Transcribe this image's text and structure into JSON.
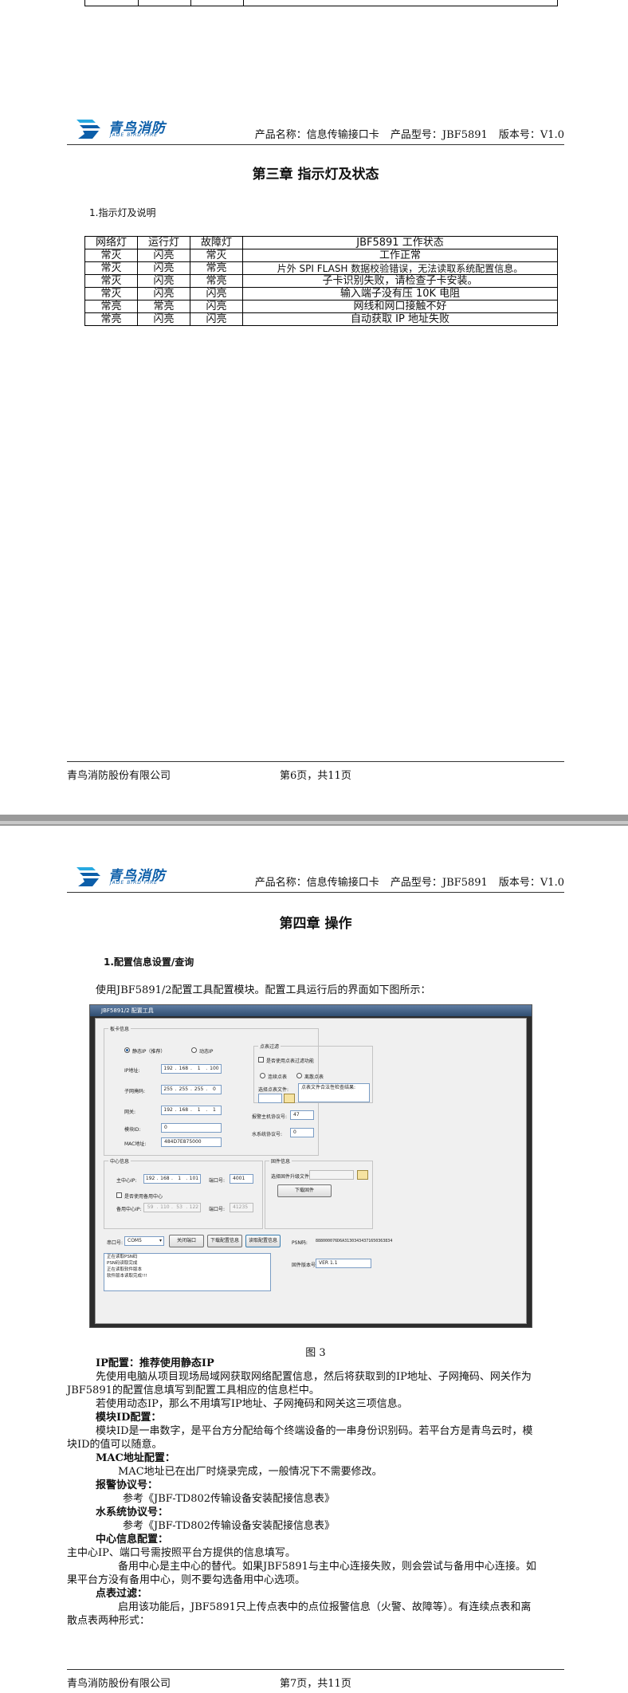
{
  "header": {
    "logo_cn": "青鸟消防",
    "logo_en": "JADE BIRD FIRE",
    "product_name": "产品名称：信息传输接口卡",
    "product_model": "产品型号：JBF5891",
    "version": "版本号：V1.0"
  },
  "page6": {
    "chapter_title": "第三章  指示灯及状态",
    "section_title": "1.指示灯及说明",
    "table": {
      "headers": [
        "网络灯",
        "运行灯",
        "故障灯",
        "JBF5891 工作状态"
      ],
      "rows": [
        [
          "常灭",
          "闪亮",
          "常灭",
          "工作正常"
        ],
        [
          "常灭",
          "闪亮",
          "常亮",
          "片外 SPI FLASH 数据校验错误，无法读取系统配置信息。"
        ],
        [
          "常灭",
          "闪亮",
          "常亮",
          "子卡识别失败，请检查子卡安装。"
        ],
        [
          "常灭",
          "闪亮",
          "闪亮",
          "输入端子没有压 10K 电阻"
        ],
        [
          "常亮",
          "常亮",
          "闪亮",
          "网线和网口接触不好"
        ],
        [
          "常亮",
          "闪亮",
          "闪亮",
          "自动获取 IP 地址失败"
        ]
      ]
    },
    "footer_company": "青鸟消防股份有限公司",
    "footer_page": "第6页，共11页"
  },
  "page7": {
    "chapter_title": "第四章  操作",
    "section_title": "1.配置信息设置/查询",
    "intro": "使用JBF5891/2配置工具配置模块。配置工具运行后的界面如下图所示：",
    "figure_caption": "图 3",
    "tool": {
      "window_title": "JBF5891/2 配置工具",
      "board_group": "板卡信息",
      "static_ip": "静态IP（推荐）",
      "dynamic_ip": "动态IP",
      "ip_label": "IP地址:",
      "ip_value": [
        "192",
        "168",
        "1",
        "100"
      ],
      "mask_label": "子网掩码:",
      "mask_value": [
        "255",
        "255",
        "255",
        "0"
      ],
      "gateway_label": "网关:",
      "gateway_value": [
        "192",
        "168",
        "1",
        "1"
      ],
      "module_id_label": "模块ID:",
      "module_id_value": "0",
      "mac_label": "MAC地址:",
      "mac_value": "484D7E875000",
      "filter_group": "点表过滤",
      "enable_filter": "是否使用点表过滤功能",
      "continuous_table": "连续点表",
      "discrete_table": "离散点表",
      "select_table_file": "选择点表文件:",
      "table_hint": "点表文件合法性检查结果:",
      "alarm_protocol_label": "报警主机协议号:",
      "alarm_protocol_value": "47",
      "water_protocol_label": "水系统协议号:",
      "water_protocol_value": "0",
      "center_group": "中心信息",
      "main_center_ip_label": "主中心IP:",
      "main_center_ip_value": [
        "192",
        "168",
        "1",
        "101"
      ],
      "main_port_label": "端口号:",
      "main_port_value": "4001",
      "use_backup": "是否使用备用中心",
      "backup_ip_label": "备用中心IP:",
      "backup_ip_value": [
        "59",
        "110",
        "53",
        "122"
      ],
      "backup_port_label": "端口号:",
      "backup_port_value": "41235",
      "firmware_group": "固件信息",
      "select_firmware": "选择固件升级文件:",
      "download_firmware": "下载固件",
      "serial_label": "串口号:",
      "serial_value": "COM5",
      "close_port": "关闭端口",
      "download_config": "下载配置信息",
      "read_config": "读取配置信息",
      "log_lines": [
        "正在读取PSN码",
        "PSN码读取完成",
        "正在读取软件版本",
        "软件版本读取完成!!!"
      ],
      "psn_label": "PSN码:",
      "psn_value": "888000076D6A31303434371650363834",
      "firmware_version_label": "固件版本号:",
      "firmware_version_value": "VER 1.1"
    },
    "items": [
      {
        "title": "IP配置：推荐使用静态IP",
        "lines": [
          "先使用电脑从项目现场局域网获取网络配置信息，然后将获取到的IP地址、子网掩码、网关作为",
          "JBF5891的配置信息填写到配置工具相应的信息栏中。",
          "若使用动态IP，那么不用填写IP地址、子网掩码和网关这三项信息。"
        ]
      },
      {
        "title": "模块ID配置：",
        "lines": [
          "模块ID是一串数字，是平台方分配给每个终端设备的一串身份识别码。若平台方是青鸟云时，模",
          "块ID的值可以随意。"
        ]
      },
      {
        "title": "MAC地址配置：",
        "lines": [
          "MAC地址已在出厂时烧录完成，一般情况下不需要修改。"
        ]
      },
      {
        "title": "报警协议号：",
        "lines": [
          "参考《JBF-TD802传输设备安装配接信息表》"
        ]
      },
      {
        "title": "水系统协议号：",
        "lines": [
          "参考《JBF-TD802传输设备安装配接信息表》"
        ]
      },
      {
        "title": "中心信息配置：",
        "lines": [
          "主中心IP、端口号需按照平台方提供的信息填写。",
          "备用中心是主中心的替代。如果JBF5891与主中心连接失败，则会尝试与备用中心连接。如",
          "果平台方没有备用中心，则不要勾选备用中心选项。"
        ]
      },
      {
        "title": "点表过滤：",
        "lines": [
          "启用该功能后，JBF5891只上传点表中的点位报警信息（火警、故障等）。有连续点表和离",
          "散点表两种形式："
        ]
      }
    ],
    "footer_company": "青鸟消防股份有限公司",
    "footer_page": "第7页，共11页"
  },
  "colors": {
    "brand": "#0c5ea9",
    "accent_light": "#27a9e1"
  }
}
